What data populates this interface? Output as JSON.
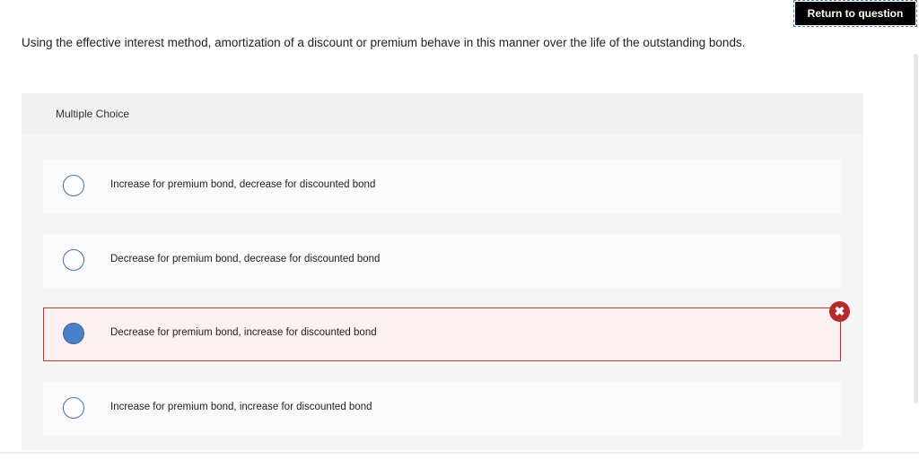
{
  "header": {
    "return_label": "Return to question"
  },
  "question": {
    "text": "Using the effective interest method, amortization of a discount or premium behave in this manner over the life of the outstanding bonds."
  },
  "multiple_choice": {
    "label": "Multiple Choice",
    "choices": [
      {
        "text": "Increase for premium bond, decrease for discounted bond",
        "selected": false,
        "state": "default"
      },
      {
        "text": "Decrease for premium bond, decrease for discounted bond",
        "selected": false,
        "state": "default"
      },
      {
        "text": "Decrease for premium bond, increase for discounted bond",
        "selected": true,
        "state": "incorrect"
      },
      {
        "text": "Increase for premium bond, increase for discounted bond",
        "selected": false,
        "state": "default"
      }
    ]
  },
  "feedback": {
    "incorrect_icon": "x-circle-icon",
    "incorrect_glyph": "✖"
  },
  "colors": {
    "accent": "#3f6fb5",
    "incorrect": "#b52b2b"
  }
}
